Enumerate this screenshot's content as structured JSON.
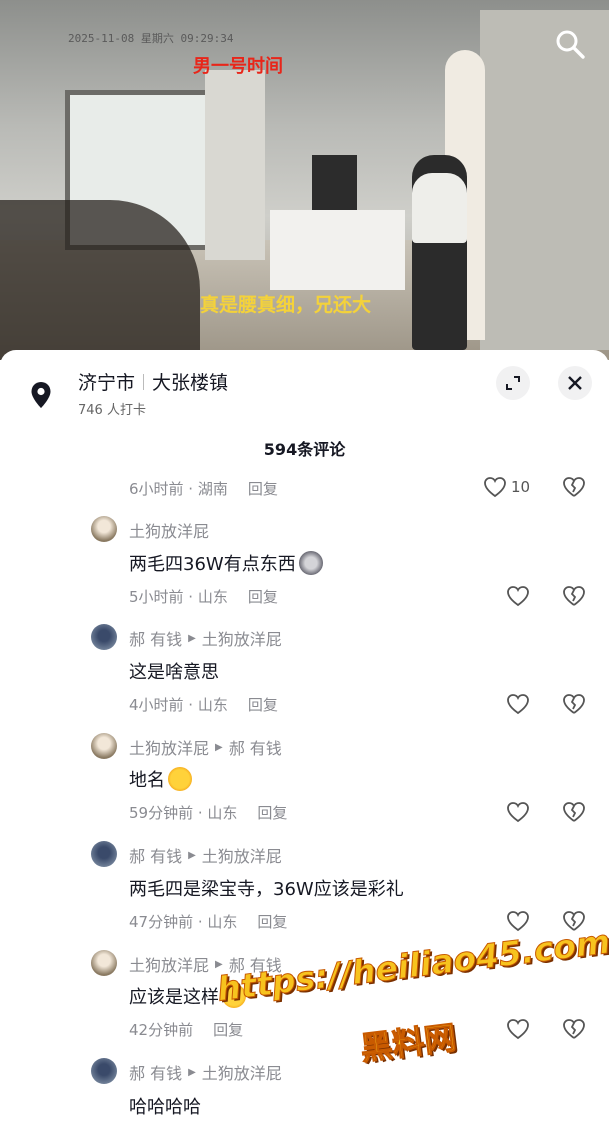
{
  "video": {
    "timestamp": "2025-11-08  星期六  09:29:34",
    "caption_top": "男一号时间",
    "caption_bottom": "真是腰真细，兄还大"
  },
  "location": {
    "city": "济宁市",
    "town": "大张楼镇",
    "checkins": "746 人打卡"
  },
  "comments_count": "594条评论",
  "first_meta": {
    "time": "6小时前 · 湖南",
    "reply": "回复",
    "likes": "10"
  },
  "comments": [
    {
      "author": "土狗放洋屁",
      "reply_to": "",
      "text": "两毛四36W有点东西",
      "time": "5小时前 · 山东",
      "reply": "回复",
      "avatar": "a"
    },
    {
      "author": "郝 有钱",
      "reply_to": "土狗放洋屁",
      "text": "这是啥意思",
      "time": "4小时前 · 山东",
      "reply": "回复",
      "avatar": "b"
    },
    {
      "author": "土狗放洋屁",
      "reply_to": "郝 有钱",
      "text": "地名",
      "time": "59分钟前 · 山东",
      "reply": "回复",
      "avatar": "a"
    },
    {
      "author": "郝 有钱",
      "reply_to": "土狗放洋屁",
      "text": "两毛四是梁宝寺，36W应该是彩礼",
      "time": "47分钟前 · 山东",
      "reply": "回复",
      "avatar": "b"
    },
    {
      "author": "土狗放洋屁",
      "reply_to": "郝 有钱",
      "text": "应该是这样",
      "time": "42分钟前",
      "reply": "回复",
      "avatar": "a"
    },
    {
      "author": "郝 有钱",
      "reply_to": "土狗放洋屁",
      "text": "哈哈哈哈",
      "time": "",
      "reply": "",
      "avatar": "b"
    }
  ],
  "watermark": {
    "line1": "https://heiliao45.com",
    "line2": "黑料网"
  }
}
